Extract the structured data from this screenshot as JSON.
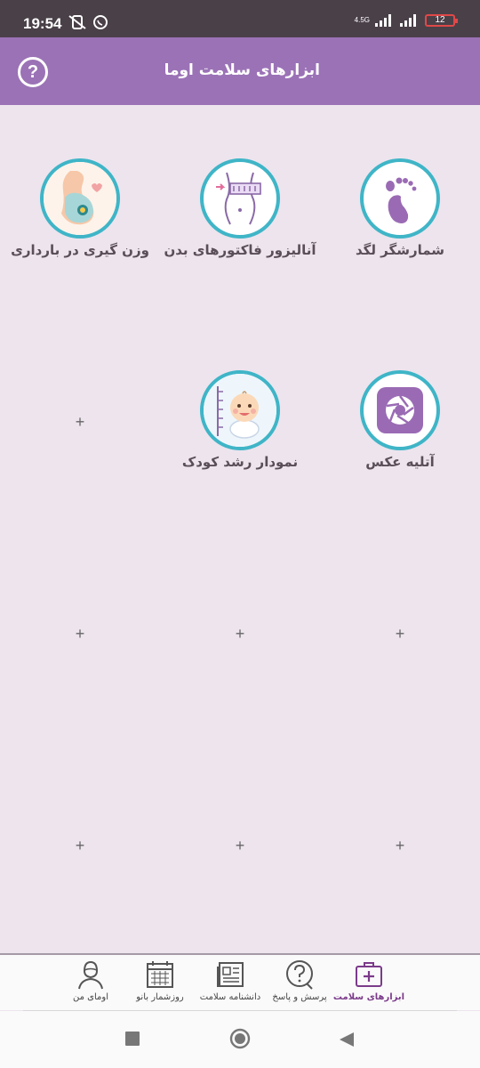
{
  "status_bar": {
    "time": "19:54",
    "network": "4.5G",
    "battery": "12",
    "icons": [
      "mute-vibrate-icon",
      "whatsapp-icon",
      "signal-icon",
      "signal-icon",
      "battery-icon"
    ]
  },
  "header": {
    "title": "ابزارهای سلامت اوما",
    "help_label": "?"
  },
  "tools": [
    {
      "label": "شمارشگر لگد",
      "icon": "footprint-icon"
    },
    {
      "label": "آنالیزور فاکتورهای بدن",
      "icon": "body-measure-icon"
    },
    {
      "label": "وزن گیری در بارداری",
      "icon": "pregnancy-icon"
    },
    {
      "label": "آتلیه عکس",
      "icon": "camera-aperture-icon"
    },
    {
      "label": "نمودار رشد کودک",
      "icon": "baby-growth-icon"
    }
  ],
  "empty_slot_label": "+",
  "bottom_nav": [
    {
      "label": "ابزارهای سلامت",
      "icon": "medical-kit-icon",
      "active": true
    },
    {
      "label": "پرسش و پاسخ",
      "icon": "question-bubble-icon",
      "active": false
    },
    {
      "label": "دانشنامه سلامت",
      "icon": "newspaper-icon",
      "active": false
    },
    {
      "label": "روزشمار بانو",
      "icon": "calendar-icon",
      "active": false
    },
    {
      "label": "اومای من",
      "icon": "user-avatar-icon",
      "active": false
    }
  ],
  "colors": {
    "header": "#9b72b6",
    "background": "#ede4ee",
    "ring": "#3fb5c7",
    "active_nav": "#7b3b8a"
  }
}
